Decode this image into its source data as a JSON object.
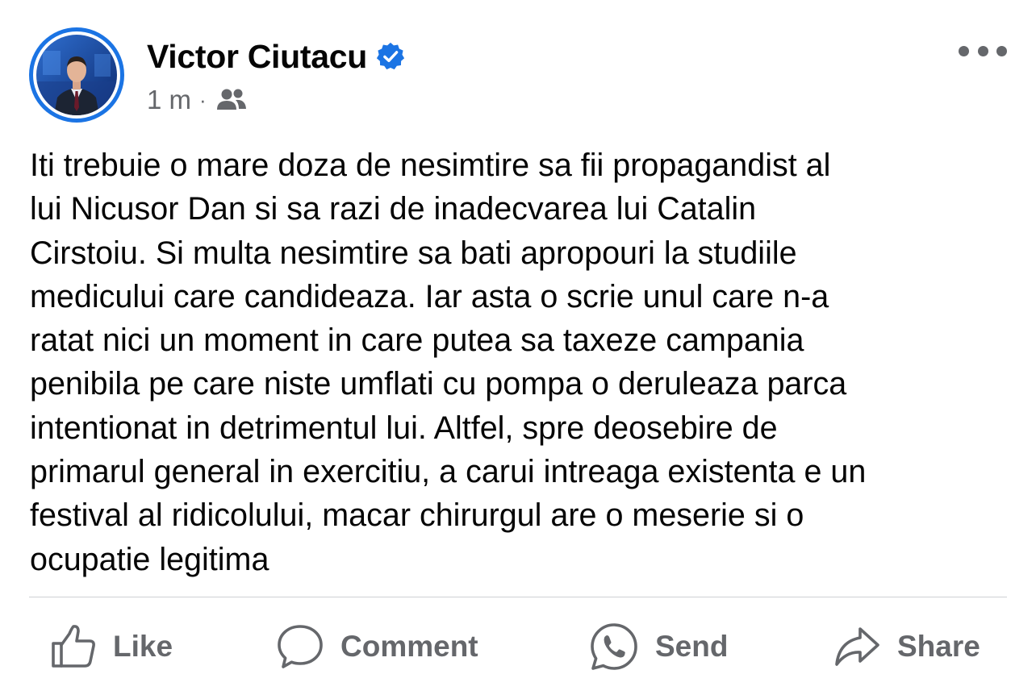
{
  "post": {
    "author": {
      "name": "Victor Ciutacu",
      "verified": true,
      "avatar_icon": "profile-photo"
    },
    "meta": {
      "time": "1 m",
      "separator": "·",
      "audience_icon": "friends-icon"
    },
    "more_icon": "more-options-icon",
    "text": "Iti trebuie o mare doza de nesimtire sa fii propagandist al\nlui Nicusor Dan si sa razi de inadecvarea lui Catalin\nCirstoiu. Si multa nesimtire sa bati apropouri la studiile\nmedicului care candideaza. Iar asta o scrie unul care n-a\nratat nici un moment in care putea sa taxeze campania\npenibila pe care niste umflati cu pompa o deruleaza parca\nintentionat in detrimentul lui. Altfel, spre deosebire de\nprimarul general in exercitiu, a carui intreaga existenta e un\nfestival al ridicolului, macar chirurgul are o meserie si o\nocupatie legitima"
  },
  "actions": [
    {
      "label": "Like",
      "icon": "thumbs-up-icon"
    },
    {
      "label": "Comment",
      "icon": "comment-bubble-icon"
    },
    {
      "label": "Send",
      "icon": "whatsapp-icon"
    },
    {
      "label": "Share",
      "icon": "share-arrow-icon"
    }
  ],
  "colors": {
    "accent": "#1b74e4",
    "text": "#050505",
    "secondary_text": "#65676b",
    "divider": "#ced0d4"
  }
}
